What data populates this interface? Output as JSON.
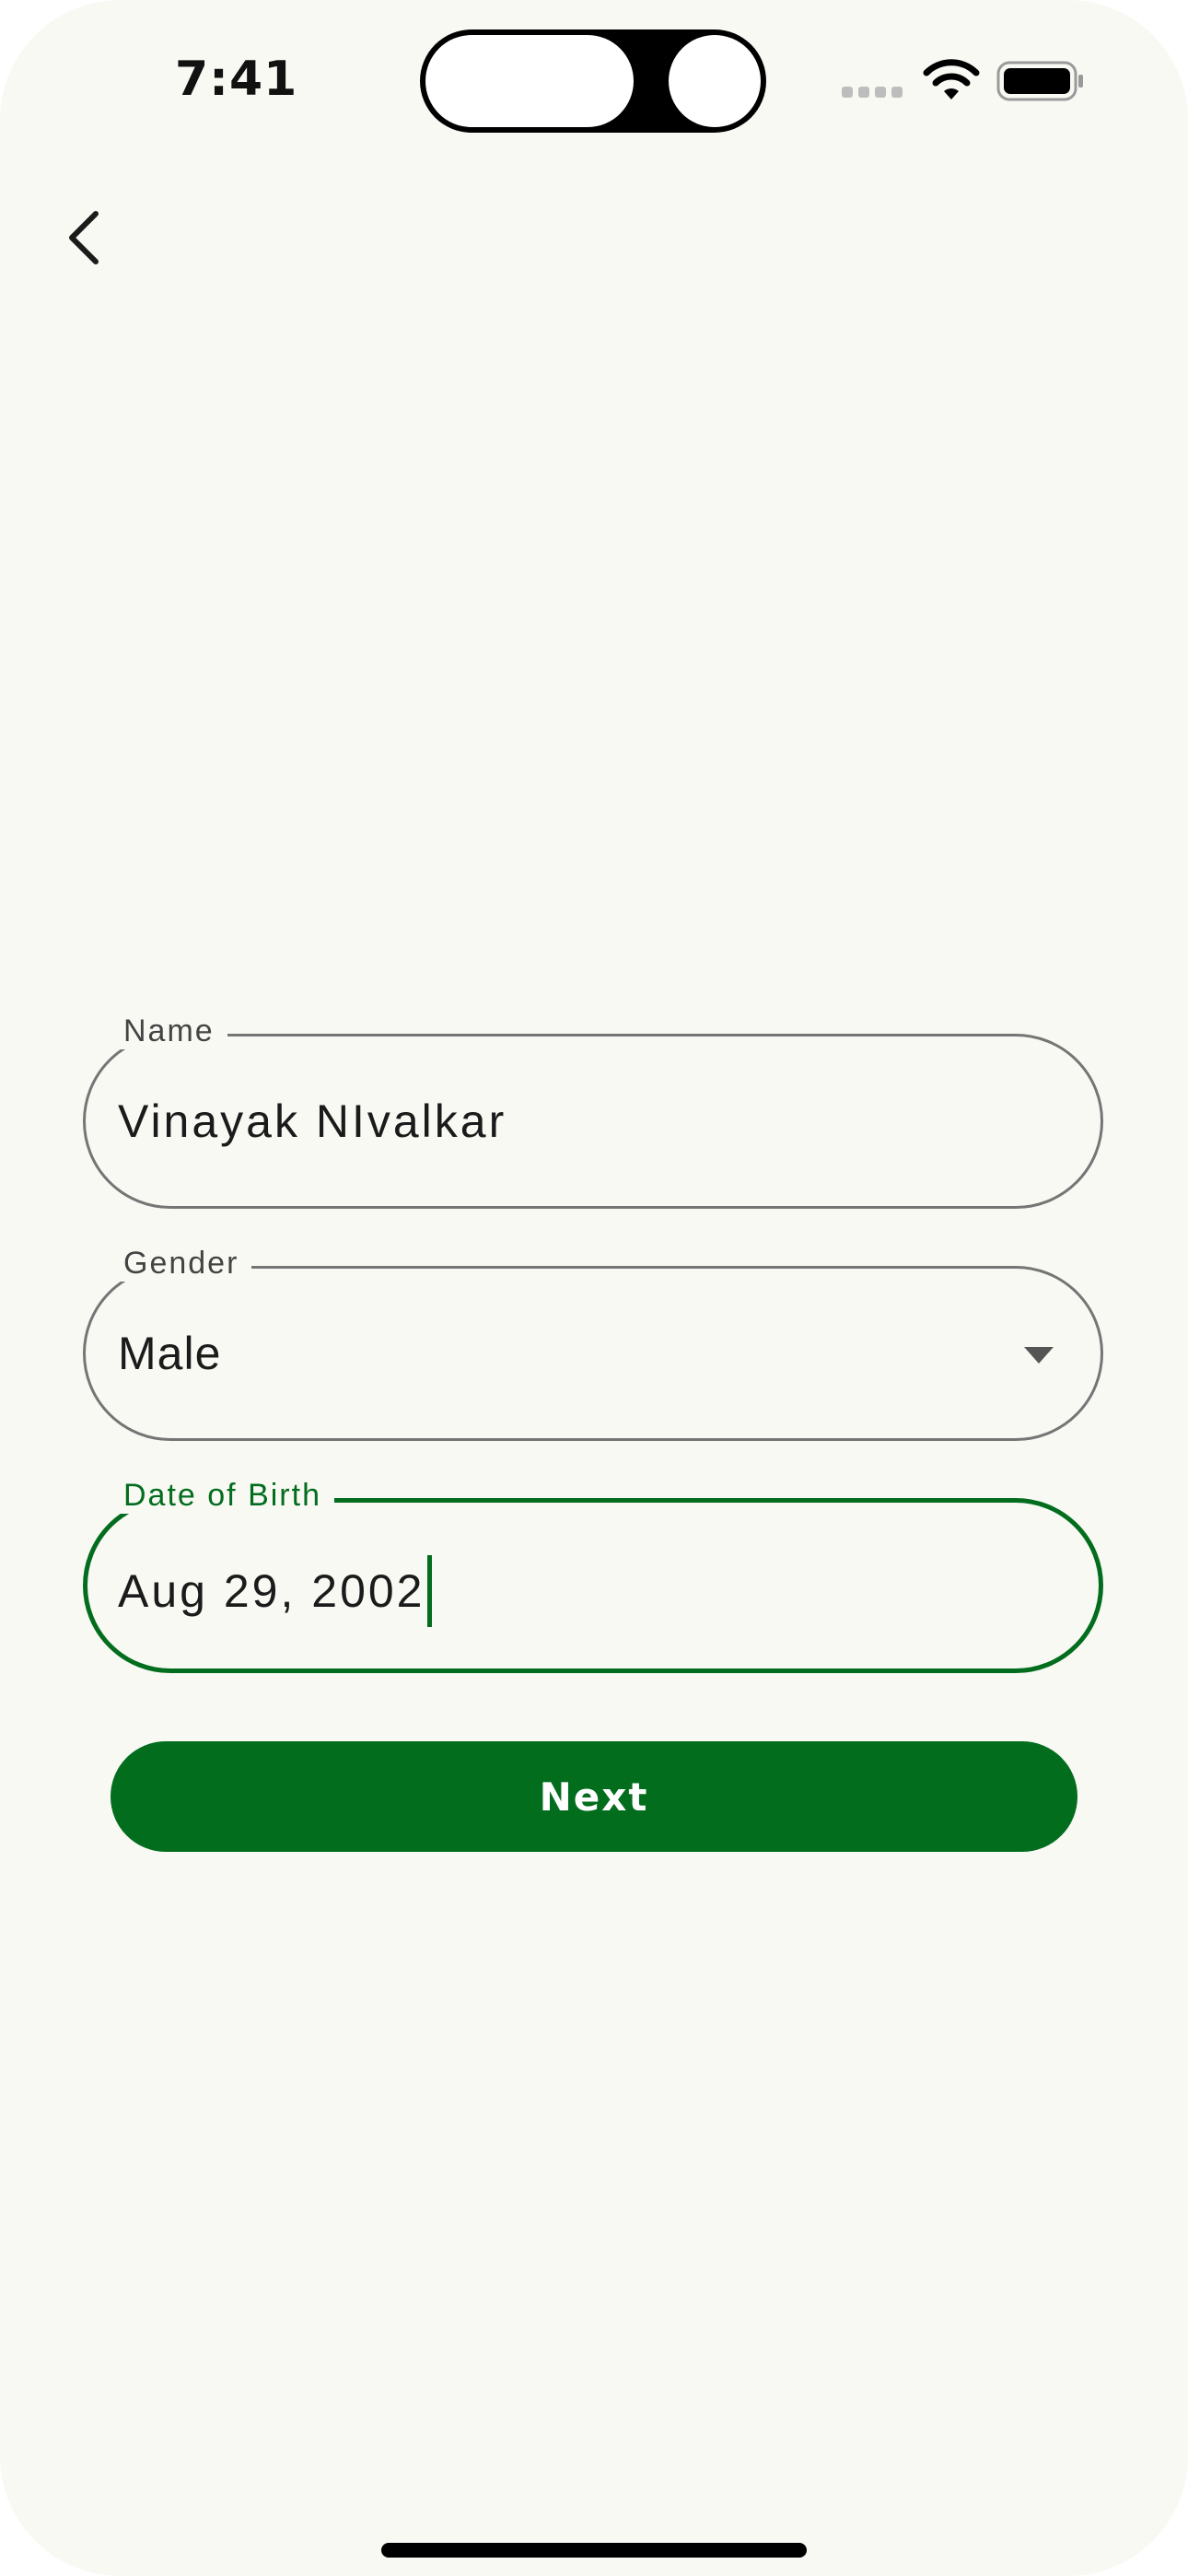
{
  "status_bar": {
    "time": "7:41"
  },
  "form": {
    "name": {
      "label": "Name",
      "value": "Vinayak NIvalkar"
    },
    "gender": {
      "label": "Gender",
      "value": "Male"
    },
    "dob": {
      "label": "Date of Birth",
      "value": "Aug 29, 2002"
    },
    "next_label": "Next"
  },
  "colors": {
    "accent": "#036d1e",
    "background": "#f9f9f4",
    "outline": "#757575"
  },
  "icons": [
    "back-chevron-icon",
    "wifi-icon",
    "battery-icon",
    "dropdown-arrow-icon"
  ]
}
